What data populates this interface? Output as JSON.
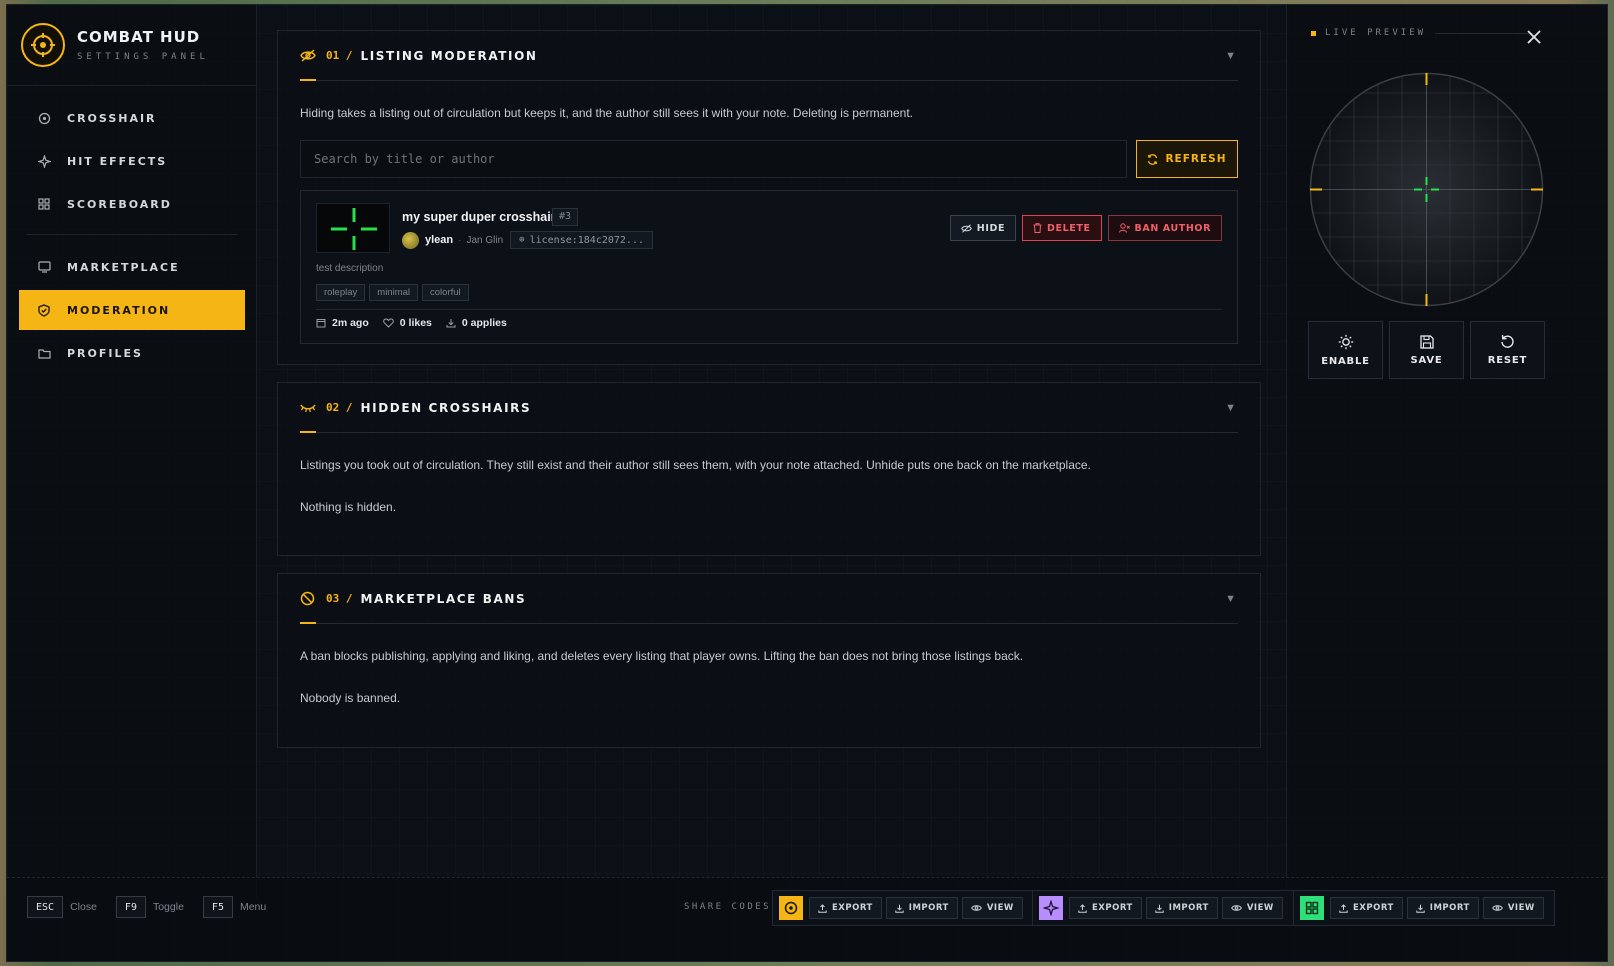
{
  "brand": {
    "title": "COMBAT HUD",
    "subtitle": "SETTINGS PANEL",
    "logo_icon": "crosshair-target-icon",
    "accent": "#f5b514"
  },
  "nav": {
    "items": [
      {
        "label": "CROSSHAIR",
        "icon": "target-icon"
      },
      {
        "label": "HIT EFFECTS",
        "icon": "sparkle-icon"
      },
      {
        "label": "SCOREBOARD",
        "icon": "grid-icon"
      },
      {
        "label": "MARKETPLACE",
        "icon": "monitor-icon"
      },
      {
        "label": "MODERATION",
        "icon": "shield-check-icon",
        "active": true
      },
      {
        "label": "PROFILES",
        "icon": "folder-icon"
      }
    ]
  },
  "sections": {
    "listing": {
      "num": "01 /",
      "title": "LISTING MODERATION",
      "description": "Hiding takes a listing out of circulation but keeps it, and the author still sees it with your note. Deleting is permanent.",
      "search_placeholder": "Search by title or author",
      "refresh_label": "REFRESH",
      "item": {
        "title": "my super duper crosshair",
        "number": "#3",
        "author": "ylean",
        "author_name": "Jan Glin",
        "license": "license:184c2072...",
        "description": "test description",
        "tags": [
          "roleplay",
          "minimal",
          "colorful"
        ],
        "time": "2m ago",
        "likes": "0 likes",
        "applies": "0 applies",
        "actions": {
          "hide": "HIDE",
          "delete": "DELETE",
          "ban": "BAN AUTHOR"
        }
      }
    },
    "hidden": {
      "num": "02 /",
      "title": "HIDDEN CROSSHAIRS",
      "description": "Listings you took out of circulation. They still exist and their author still sees them, with your note attached. Unhide puts one back on the marketplace.",
      "empty": "Nothing is hidden."
    },
    "bans": {
      "num": "03 /",
      "title": "MARKETPLACE BANS",
      "description": "A ban blocks publishing, applying and liking, and deletes every listing that player owns. Lifting the ban does not bring those listings back.",
      "empty": "Nobody is banned."
    }
  },
  "preview": {
    "label": "LIVE PREVIEW",
    "crosshair_color": "#27e04a",
    "controls": {
      "enable": "ENABLE",
      "save": "SAVE",
      "reset": "RESET"
    }
  },
  "footer": {
    "keys": [
      {
        "key": "ESC",
        "label": "Close"
      },
      {
        "key": "F9",
        "label": "Toggle"
      },
      {
        "key": "F5",
        "label": "Menu"
      }
    ],
    "share_label": "SHARE CODES",
    "share_buttons": {
      "export": "EXPORT",
      "import": "IMPORT",
      "view": "VIEW"
    },
    "share_colors": {
      "crosshair": "#f5b514",
      "hit_effects": "#b98cff",
      "scoreboard": "#2fe07a"
    }
  }
}
